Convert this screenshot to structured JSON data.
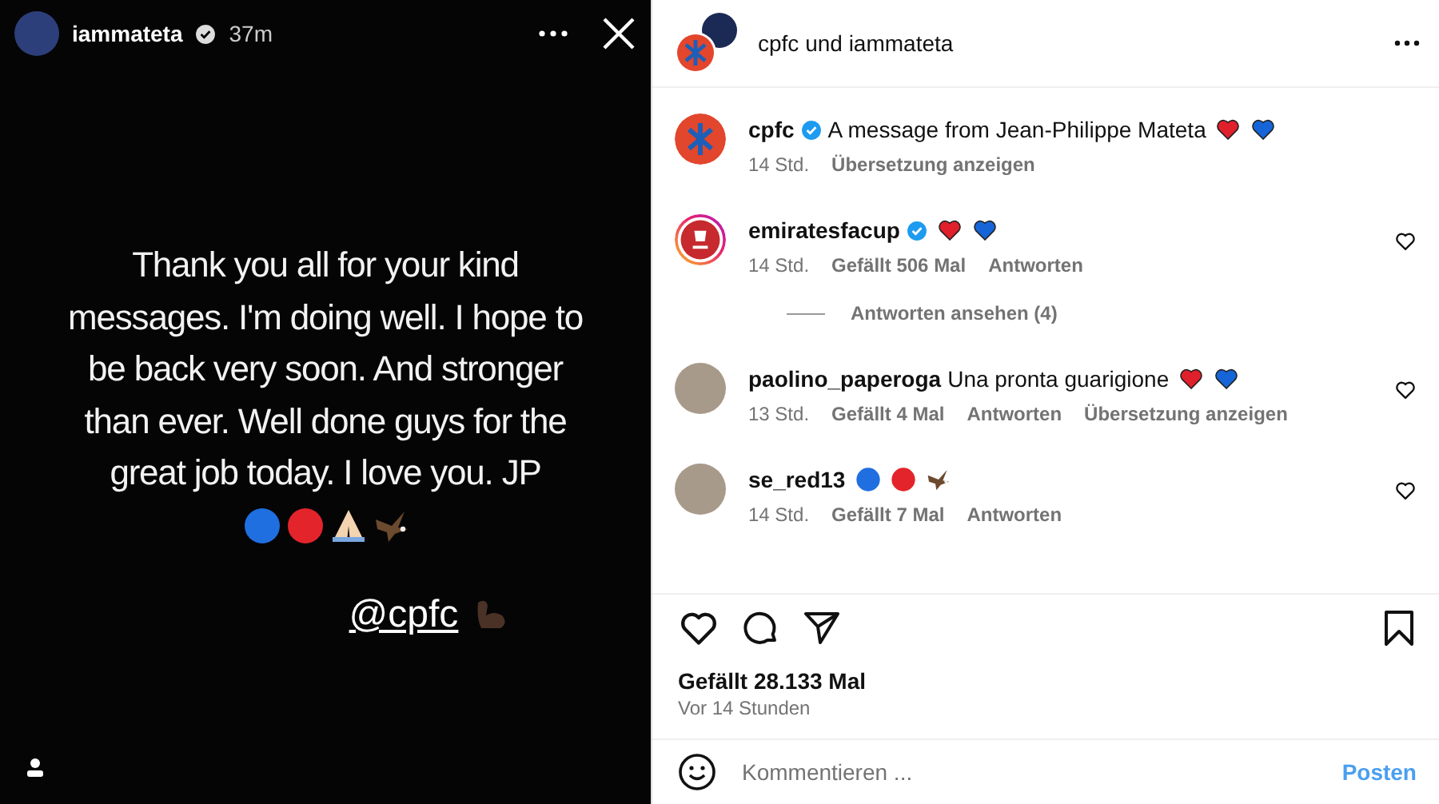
{
  "story": {
    "username": "iammateta",
    "verified": true,
    "time": "37m",
    "text": "Thank you all for your kind messages. I'm doing well. I hope to be back very soon. And stronger than ever. Well done guys for the great job today. I love you. JP",
    "emojis": [
      {
        "kind": "blue_circle"
      },
      {
        "kind": "red_circle"
      },
      {
        "kind": "folded_hands"
      },
      {
        "kind": "eagle"
      }
    ],
    "mention": "@cpfc",
    "mention_emojis": [
      {
        "kind": "flexed_arm"
      }
    ]
  },
  "post": {
    "header_title": "cpfc und iammateta",
    "caption": {
      "username": "cpfc",
      "verified": true,
      "text": "A message from Jean-Philippe Mateta",
      "emojis": [
        {
          "kind": "red_heart"
        },
        {
          "kind": "blue_heart"
        }
      ],
      "time": "14 Std.",
      "translate": "Übersetzung anzeigen"
    },
    "comments": [
      {
        "has_story": true,
        "username": "emiratesfacup",
        "verified": true,
        "emojis": [
          {
            "kind": "red_heart"
          },
          {
            "kind": "blue_heart"
          }
        ],
        "time": "14 Std.",
        "likes": "Gefällt 506 Mal",
        "reply": "Antworten",
        "view_replies": "Antworten ansehen (4)"
      },
      {
        "has_story": false,
        "username": "paolino_paperoga",
        "verified": false,
        "text": "Una pronta guarigione",
        "emojis": [
          {
            "kind": "red_heart"
          },
          {
            "kind": "blue_heart"
          }
        ],
        "time": "13 Std.",
        "likes": "Gefällt 4 Mal",
        "reply": "Antworten",
        "translate": "Übersetzung anzeigen"
      },
      {
        "has_story": false,
        "username": "se_red13",
        "verified": false,
        "emojis": [
          {
            "kind": "blue_circle"
          },
          {
            "kind": "red_circle"
          },
          {
            "kind": "eagle"
          }
        ],
        "time": "14 Std.",
        "likes": "Gefällt 7 Mal",
        "reply": "Antworten"
      }
    ],
    "likes": "Gefällt 28.133 Mal",
    "date": "Vor 14 Stunden",
    "comment_placeholder": "Kommentieren ...",
    "post_button": "Posten"
  }
}
